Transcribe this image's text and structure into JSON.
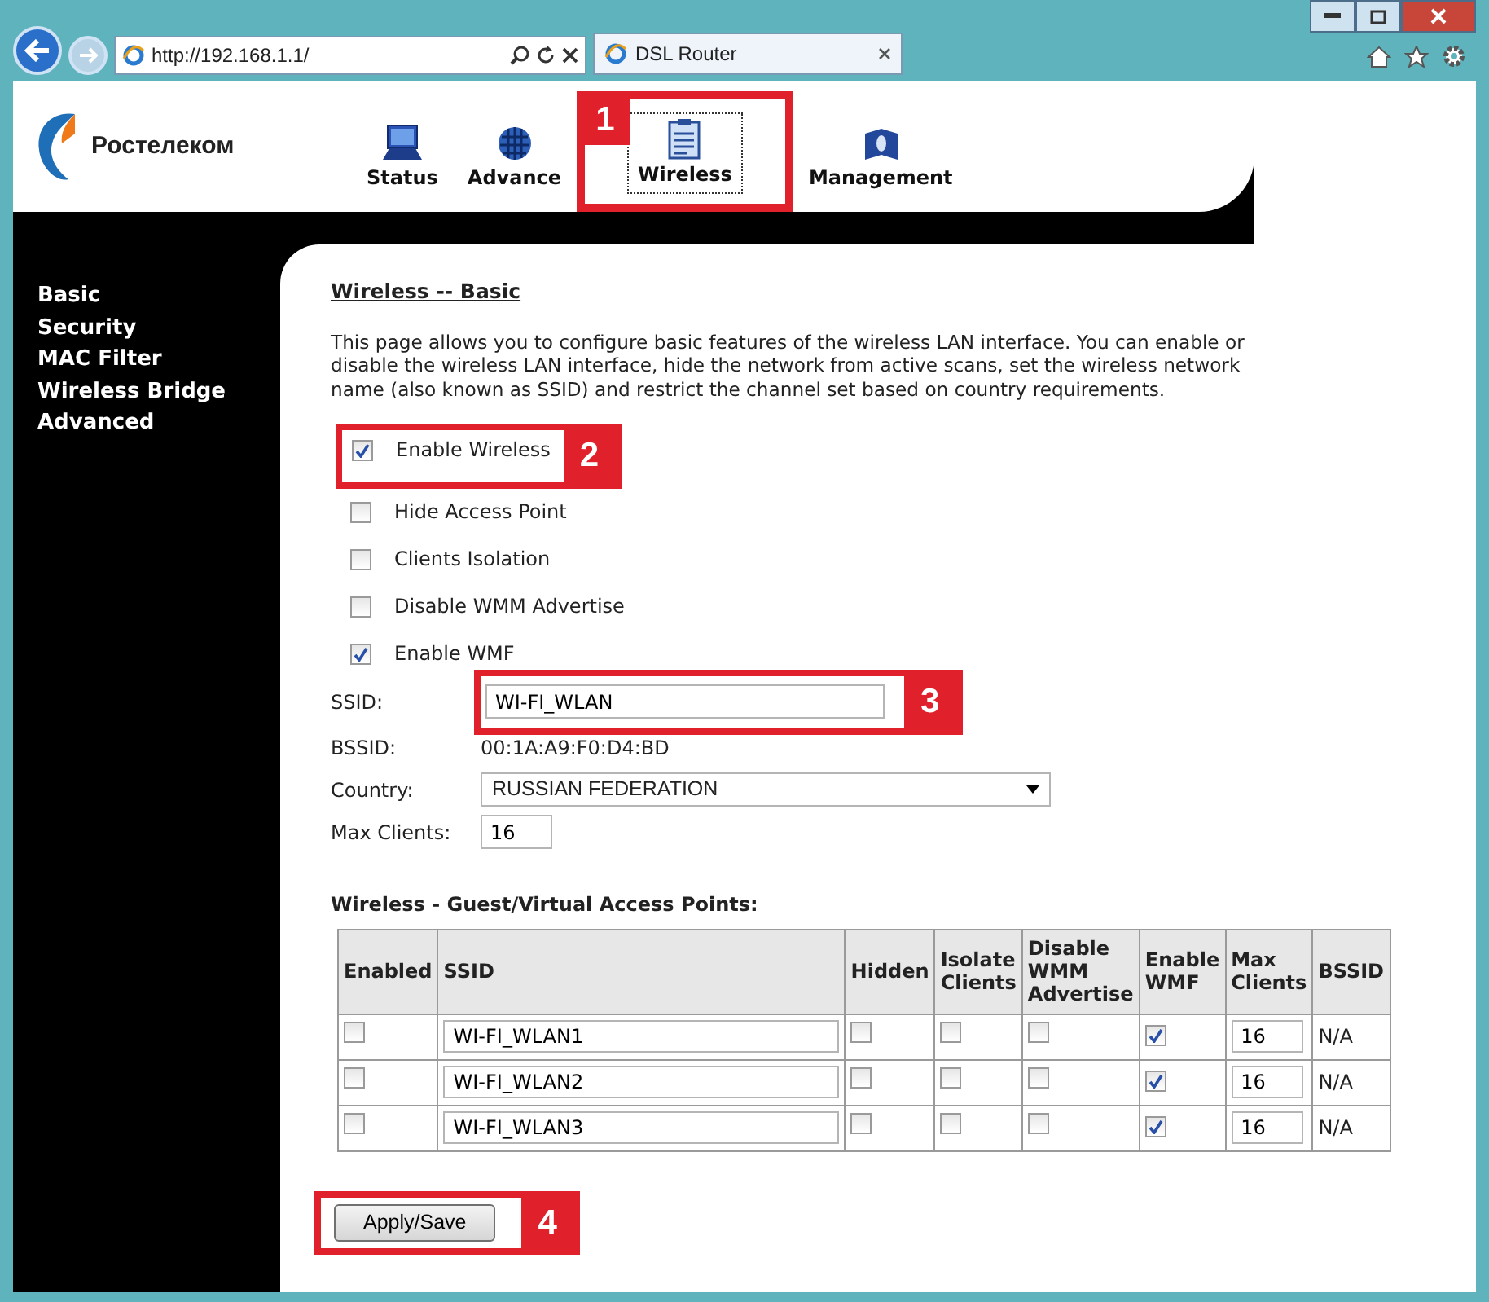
{
  "browser": {
    "address": "http://192.168.1.1/",
    "tab_title": "DSL Router"
  },
  "logo": {
    "text": "Ростелеком"
  },
  "top_nav": [
    {
      "label": "Status",
      "selected": false
    },
    {
      "label": "Advance",
      "selected": false
    },
    {
      "label": "Wireless",
      "selected": true,
      "callout": "1"
    },
    {
      "label": "Management",
      "selected": false
    }
  ],
  "sidebar": {
    "items": [
      "Basic",
      "Security",
      "MAC Filter",
      "Wireless Bridge",
      "Advanced"
    ]
  },
  "content": {
    "title": "Wireless -- Basic",
    "description": "This page allows you to configure basic features of the wireless LAN interface. You can enable or disable the wireless LAN interface, hide the network from active scans, set the wireless network name (also known as SSID) and restrict the channel set based on country requirements.",
    "options": [
      {
        "label": "Enable Wireless",
        "checked": true,
        "callout": "2"
      },
      {
        "label": "Hide Access Point",
        "checked": false
      },
      {
        "label": "Clients Isolation",
        "checked": false
      },
      {
        "label": "Disable WMM Advertise",
        "checked": false
      },
      {
        "label": "Enable WMF",
        "checked": true
      }
    ],
    "fields": [
      {
        "kind": "input",
        "label": "SSID:",
        "value": "WI-FI_WLAN",
        "callout": "3"
      },
      {
        "kind": "text",
        "label": "BSSID:",
        "value": "00:1A:A9:F0:D4:BD"
      },
      {
        "kind": "select",
        "label": "Country:",
        "value": "RUSSIAN FEDERATION"
      },
      {
        "kind": "short",
        "label": "Max Clients:",
        "value": "16"
      }
    ],
    "guest_title": "Wireless - Guest/Virtual Access Points:",
    "table": {
      "columns": [
        "Enabled",
        "SSID",
        "Hidden",
        "Isolate Clients",
        "Disable WMM Advertise",
        "Enable WMF",
        "Max Clients",
        "BSSID"
      ],
      "rows": [
        {
          "enabled": false,
          "ssid": "WI-FI_WLAN1",
          "hidden": false,
          "isolate": false,
          "disable_wmm": false,
          "enable_wmf": true,
          "max_clients": "16",
          "bssid": "N/A"
        },
        {
          "enabled": false,
          "ssid": "WI-FI_WLAN2",
          "hidden": false,
          "isolate": false,
          "disable_wmm": false,
          "enable_wmf": true,
          "max_clients": "16",
          "bssid": "N/A"
        },
        {
          "enabled": false,
          "ssid": "WI-FI_WLAN3",
          "hidden": false,
          "isolate": false,
          "disable_wmm": false,
          "enable_wmf": true,
          "max_clients": "16",
          "bssid": "N/A"
        }
      ]
    },
    "apply_button": {
      "label": "Apply/Save",
      "callout": "4"
    }
  }
}
